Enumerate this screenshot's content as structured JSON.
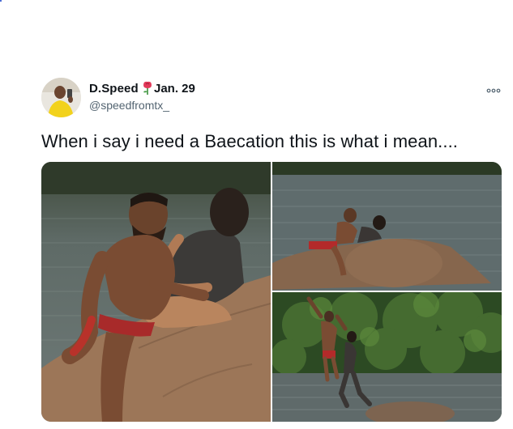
{
  "tweet": {
    "display_name": "D.Speed",
    "date": "Jan. 29",
    "handle": "@speedfromtx_",
    "text": "When i say i need a Baecation this is what i mean...."
  },
  "icons": {
    "more": "more-options-icon",
    "rose": "rose-emoji-icon"
  },
  "colors": {
    "text": "#0f1419",
    "secondary_text": "#536471",
    "water": "#5d6a6c",
    "elephant": "#9a7355",
    "foliage": "#2f4a22"
  }
}
